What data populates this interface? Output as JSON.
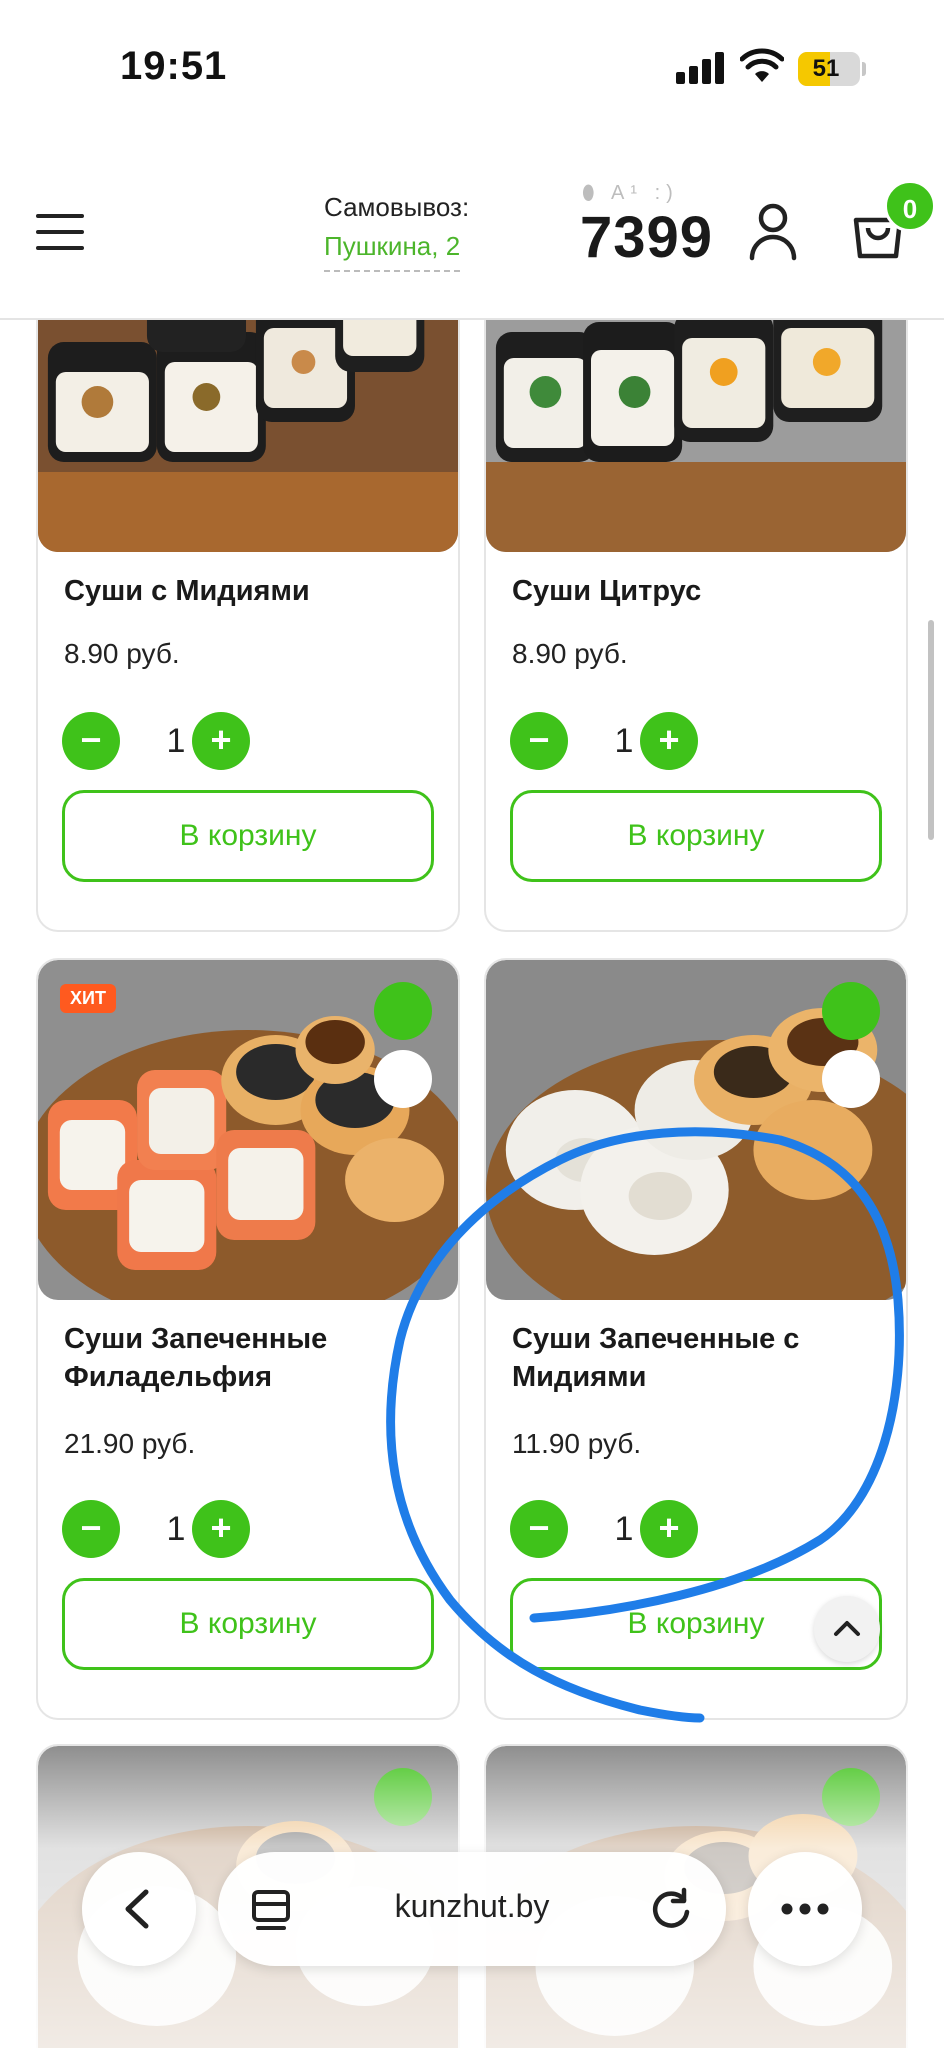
{
  "status_bar": {
    "time": "19:51",
    "battery": "51",
    "battery_level": 0.51
  },
  "header": {
    "pickup_label": "Самовывоз:",
    "pickup_address": "Пушкина, 2",
    "phone_icons": "⬮ A¹ :)",
    "phone_number": "7399",
    "cart_count": "0",
    "icons": [
      "menu-icon",
      "user-icon",
      "cart-icon"
    ]
  },
  "products": [
    {
      "title": "Суши с Мидиями",
      "price": "8.90 руб.",
      "qty": "1",
      "button": "В корзину"
    },
    {
      "title": "Суши Цитрус",
      "price": "8.90 руб.",
      "qty": "1",
      "button": "В корзину"
    },
    {
      "title": "Суши Запеченные Филадельфия",
      "price": "21.90 руб.",
      "qty": "1",
      "button": "В корзину",
      "badge": "ХИТ"
    },
    {
      "title": "Суши Запеченные с Мидиями",
      "price": "11.90 руб.",
      "qty": "1",
      "button": "В корзину"
    }
  ],
  "controls": {
    "minus": "−",
    "plus": "+"
  },
  "browser": {
    "url": "kunzhut.by",
    "icons": [
      "back-icon",
      "reader-icon",
      "reload-icon",
      "more-icon"
    ]
  },
  "colors": {
    "accent": "#3fc21a",
    "badge": "#ff5a1f",
    "annotation": "#1f7de8"
  }
}
